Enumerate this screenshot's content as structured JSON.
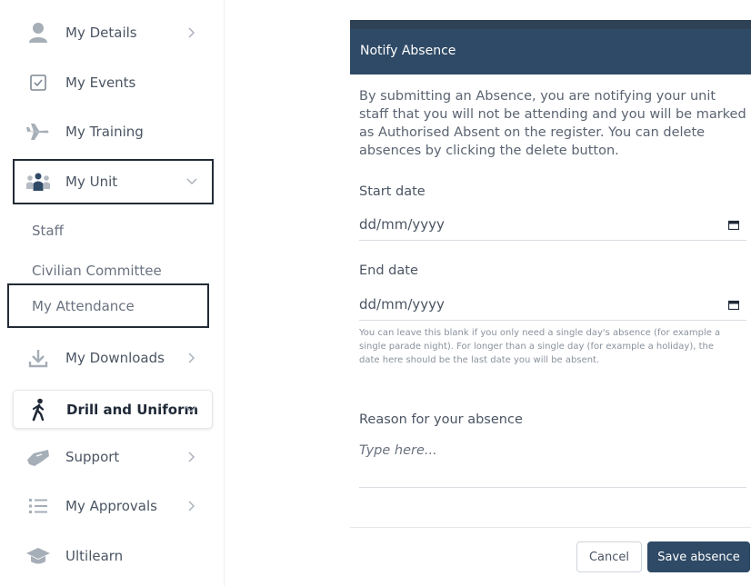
{
  "sidebar": {
    "items": [
      {
        "label": "My Details",
        "icon": "person-icon"
      },
      {
        "label": "My Events",
        "icon": "checkbox-icon"
      },
      {
        "label": "My Training",
        "icon": "plane-icon"
      },
      {
        "label": "My Unit",
        "icon": "group-icon"
      },
      {
        "label": "My Downloads",
        "icon": "download-icon"
      },
      {
        "label": "Drill and Uniform",
        "icon": "walking-person-icon"
      },
      {
        "label": "Support",
        "icon": "handshake-icon"
      },
      {
        "label": "My Approvals",
        "icon": "list-icon"
      },
      {
        "label": "Ultilearn",
        "icon": "graduation-cap-icon"
      }
    ],
    "sub_items": [
      {
        "label": "Staff"
      },
      {
        "label": "Civilian Committee"
      },
      {
        "label": "My Attendance"
      }
    ]
  },
  "modal": {
    "title": "Notify Absence",
    "intro": "By submitting an Absence, you are notifying your unit staff that you will not be attending and you will be marked as Authorised Absent on the register. You can delete absences by clicking the delete button.",
    "start_date_label": "Start date",
    "start_date_placeholder": "dd/mm/yyyy",
    "end_date_label": "End date",
    "end_date_placeholder": "dd/mm/yyyy",
    "help_text": "You can leave this blank if you only need a single day's absence (for example a single parade night). For longer than a single day (for example a holiday), the date here should be the last date you will be absent.",
    "reason_label": "Reason for your absence",
    "reason_placeholder": "Type here...",
    "cancel_label": "Cancel",
    "save_label": "Save absence"
  },
  "colors": {
    "header": "#2f4a66",
    "icon": "#9aa3ad",
    "border_highlight": "#222b36"
  }
}
